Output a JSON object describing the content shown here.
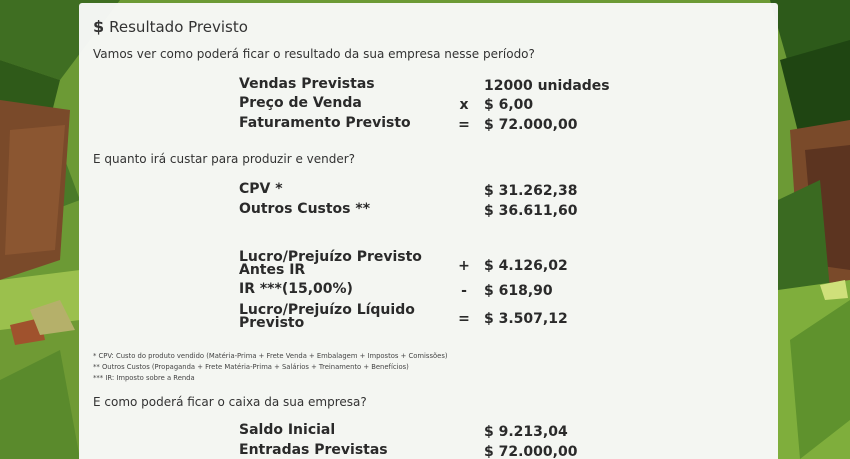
{
  "header": {
    "icon": "dollar-icon",
    "title": "Resultado Previsto"
  },
  "intro_question": "Vamos ver como poderá ficar o resultado da sua empresa nesse período?",
  "sales": [
    {
      "label": "Vendas Previstas",
      "op": "",
      "value": "12000 unidades"
    },
    {
      "label": "Preço de Venda",
      "op": "x",
      "value": "$ 6,00"
    },
    {
      "label": "Faturamento Previsto",
      "op": "=",
      "value": "$ 72.000,00"
    }
  ],
  "cost_question": "E quanto irá custar para produzir e vender?",
  "costs": [
    {
      "label": "CPV *",
      "op": "",
      "value": "$ 31.262,38"
    },
    {
      "label": "Outros Custos **",
      "op": "",
      "value": "$ 36.611,60"
    }
  ],
  "results": [
    {
      "label": "Lucro/Prejuízo Previsto Antes IR",
      "op": "+",
      "value": "$ 4.126,02"
    },
    {
      "label": "IR ***(15,00%)",
      "op": "-",
      "value": "$ 618,90"
    },
    {
      "label": "Lucro/Prejuízo Líquido Previsto",
      "op": "=",
      "value": "$ 3.507,12"
    }
  ],
  "notes": [
    "* CPV: Custo do produto vendido (Matéria-Prima + Frete Venda + Embalagem + Impostos + Comissões)",
    "** Outros Custos (Propaganda + Frete Matéria-Prima + Salários + Treinamento + Benefícios)",
    "*** IR: Imposto sobre a Renda"
  ],
  "cash_question": "E como poderá ficar o caixa da sua empresa?",
  "cash": [
    {
      "label": "Saldo Inicial",
      "op": "",
      "value": "$ 9.213,04"
    },
    {
      "label": "Entradas Previstas",
      "op": "",
      "value": "$ 72.000,00"
    }
  ]
}
